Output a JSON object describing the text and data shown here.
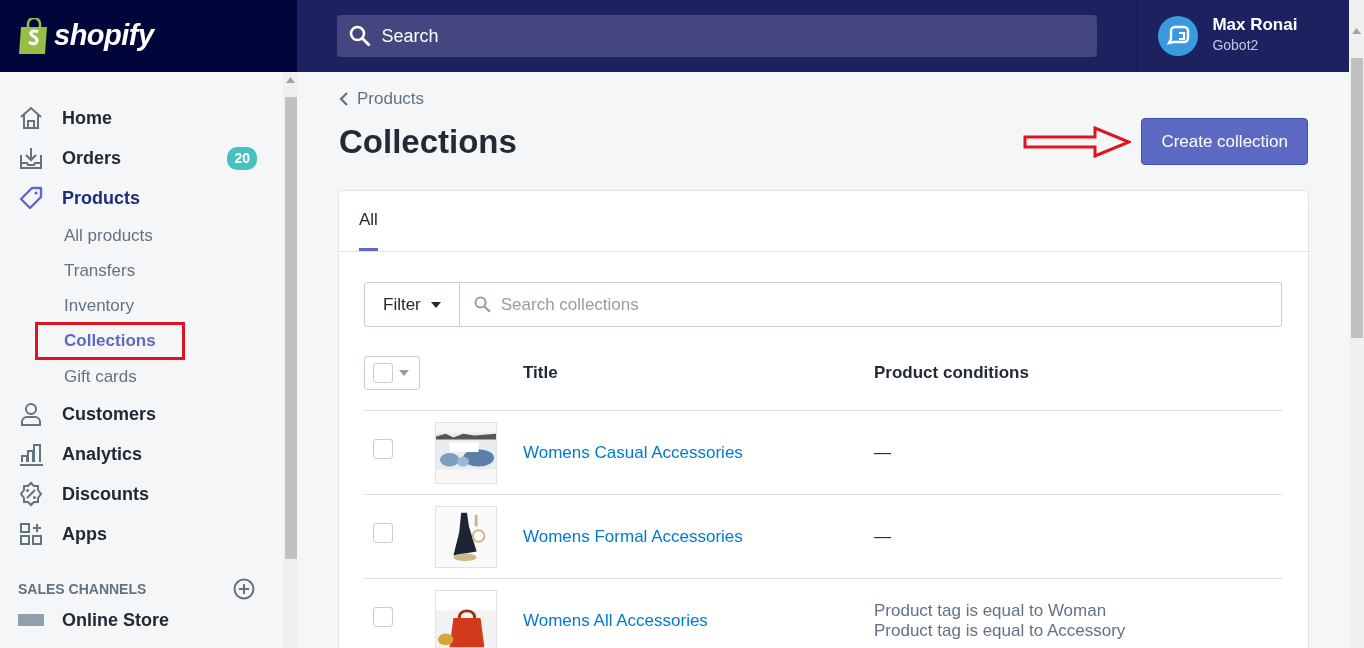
{
  "brand": {
    "name": "shopify"
  },
  "search": {
    "placeholder": "Search"
  },
  "user": {
    "name": "Max Ronai",
    "store": "Gobot2"
  },
  "sidebar": {
    "items": [
      {
        "label": "Home",
        "selected": false
      },
      {
        "label": "Orders",
        "badge": "20",
        "selected": false
      },
      {
        "label": "Products",
        "selected": true,
        "children": [
          {
            "label": "All products",
            "selected": false,
            "highlighted": false
          },
          {
            "label": "Transfers",
            "selected": false,
            "highlighted": false
          },
          {
            "label": "Inventory",
            "selected": false,
            "highlighted": false
          },
          {
            "label": "Collections",
            "selected": true,
            "highlighted": true
          },
          {
            "label": "Gift cards",
            "selected": false,
            "highlighted": false
          }
        ]
      },
      {
        "label": "Customers",
        "selected": false
      },
      {
        "label": "Analytics",
        "selected": false
      },
      {
        "label": "Discounts",
        "selected": false
      },
      {
        "label": "Apps",
        "selected": false
      }
    ],
    "section": {
      "title": "SALES CHANNELS",
      "items": [
        {
          "label": "Online Store"
        }
      ]
    }
  },
  "breadcrumb": "Products",
  "page_title": "Collections",
  "primary_button": {
    "label": "Create collection",
    "pointed_by_arrow": true
  },
  "tabs": [
    {
      "label": "All",
      "selected": true
    }
  ],
  "filter": {
    "label": "Filter",
    "placeholder": "Search collections"
  },
  "table": {
    "columns": [
      "Title",
      "Product conditions"
    ],
    "select_all_checked": false,
    "rows": [
      {
        "checked": false,
        "title": "Womens Casual Accessories",
        "conditions": [
          "—"
        ]
      },
      {
        "checked": false,
        "title": "Womens Formal Accessories",
        "conditions": [
          "—"
        ]
      },
      {
        "checked": false,
        "title": "Womens All Accessories",
        "conditions": [
          "Product tag is equal to Woman",
          "Product tag is equal to Accessory"
        ]
      }
    ]
  }
}
